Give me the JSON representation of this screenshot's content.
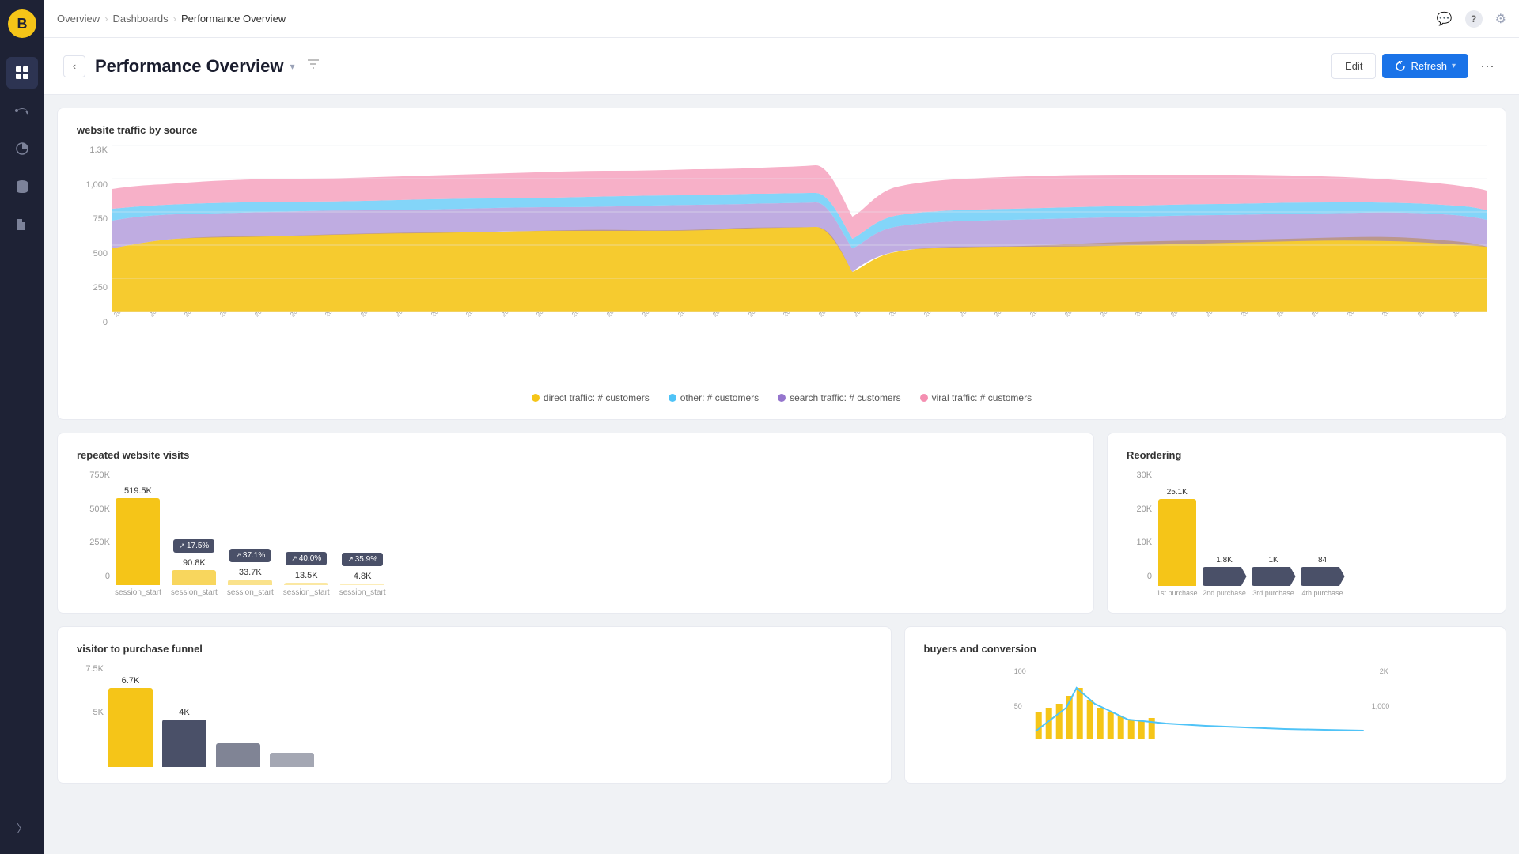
{
  "app": {
    "logo": "B",
    "logo_bg": "#f5c518"
  },
  "breadcrumb": {
    "items": [
      "Overview",
      "Dashboards",
      "Performance Overview"
    ],
    "separator": "›"
  },
  "topbar": {
    "chat_icon": "💬",
    "help_icon": "?",
    "settings_icon": "⚙"
  },
  "header": {
    "title": "Performance Overview",
    "back_label": "‹",
    "dropdown_icon": "▾",
    "filter_icon": "⊲",
    "edit_label": "Edit",
    "refresh_label": "Refresh",
    "more_icon": "···"
  },
  "nav_icons": [
    {
      "name": "dashboard-icon",
      "symbol": "▦",
      "active": true
    },
    {
      "name": "megaphone-icon",
      "symbol": "📢",
      "active": false
    },
    {
      "name": "chart-icon",
      "symbol": "◔",
      "active": false
    },
    {
      "name": "database-icon",
      "symbol": "◫",
      "active": false
    },
    {
      "name": "folder-icon",
      "symbol": "▭",
      "active": false
    }
  ],
  "traffic_chart": {
    "title": "website traffic by source",
    "y_labels": [
      "1.3K",
      "1,000",
      "750",
      "500",
      "250",
      "0"
    ],
    "x_labels": [
      "2017-12-31",
      "2018-01-20",
      "2018-01-30",
      "2018-02-09",
      "2018-02-19",
      "2018-03-01",
      "2018-03-11",
      "2018-03-31",
      "2018-04-10",
      "2018-04-20",
      "2018-04-30",
      "2018-05-10",
      "2018-05-20",
      "2018-05-30",
      "2018-06-09",
      "2018-06-19",
      "2018-06-29",
      "2018-07-09",
      "2018-07-19",
      "2018-07-29",
      "2018-08-08",
      "2018-08-18",
      "2018-08-28",
      "2018-09-07",
      "2018-09-17",
      "2018-09-27",
      "2018-10-07",
      "2018-10-17",
      "2018-10-27",
      "2018-11-06",
      "2018-11-16",
      "2018-11-26",
      "2018-12-06",
      "2018-12-16",
      "2018-12-26",
      "2019-01-05",
      "2019-01-25",
      "2019-02-04",
      "2019-02-14",
      "2019-02-24",
      "2019-03-06",
      "2019-03-16",
      "2019-03-26",
      "2019-04-05",
      "2019-04-15",
      "2019-04-25",
      "2019-05-05",
      "2019-05-15",
      "2019-05-25",
      "2019-06-04",
      "2019-06-14",
      "2019-06-24",
      "2019-07-04",
      "2019-07-14",
      "2019-07-24",
      "2019-08-03",
      "2019-08-13",
      "2019-08-23",
      "2019-09-02",
      "2019-09-12",
      "2019-09-22",
      "2019-10-02",
      "2019-10-12",
      "2019-10-22",
      "2019-11-01",
      "2019-11-11",
      "2019-11-21",
      "2019-12-01",
      "2019-12-11",
      "2019-12-21",
      "2019-12-31",
      "2020-01-10",
      "2020-01-20",
      "2020-01-30",
      "2020-02-09",
      "2020-02-19",
      "2020-02-29"
    ],
    "legend": [
      {
        "label": "direct traffic: # customers",
        "color": "#f5c518"
      },
      {
        "label": "other: # customers",
        "color": "#4fc3f7"
      },
      {
        "label": "search traffic: # customers",
        "color": "#9575cd"
      },
      {
        "label": "viral traffic: # customers",
        "color": "#f48fb1"
      }
    ]
  },
  "repeated_visits": {
    "title": "repeated website visits",
    "y_labels": [
      "750K",
      "500K",
      "250K",
      "0"
    ],
    "bars": [
      {
        "value": "519.5K",
        "label": "session_start",
        "height_pct": 100,
        "is_yellow": true,
        "arrow": null
      },
      {
        "value": "90.8K",
        "label": "session_start",
        "height_pct": 17,
        "is_yellow": false,
        "arrow": "17.5%"
      },
      {
        "value": "33.7K",
        "label": "session_start",
        "height_pct": 6,
        "is_yellow": false,
        "arrow": "37.1%"
      },
      {
        "value": "13.5K",
        "label": "session_start",
        "height_pct": 3,
        "is_yellow": false,
        "arrow": "40.0%"
      },
      {
        "value": "4.8K",
        "label": "session_start",
        "height_pct": 1,
        "is_yellow": false,
        "arrow": "35.9%"
      }
    ]
  },
  "reordering": {
    "title": "Reordering",
    "y_labels": [
      "30K",
      "20K",
      "10K",
      "0"
    ],
    "bars": [
      {
        "value": "25.1K",
        "label": "1st purchase",
        "height_pct": 100,
        "is_yellow": true
      },
      {
        "value": "1.8K",
        "label": "2nd purchase",
        "height_pct": 7,
        "is_yellow": false
      },
      {
        "value": "1K",
        "label": "3rd purchase",
        "height_pct": 4,
        "is_yellow": false
      },
      {
        "value": "84",
        "label": "4th purchase",
        "height_pct": 1,
        "is_yellow": false
      }
    ]
  },
  "visitor_funnel": {
    "title": "visitor to purchase funnel",
    "y_labels": [
      "7.5K",
      "5K"
    ],
    "bars": [
      {
        "value": "6.7K",
        "label": "",
        "height_pct": 100,
        "is_yellow": true
      },
      {
        "value": "4K",
        "label": "",
        "height_pct": 60,
        "is_dark": true
      }
    ]
  },
  "buyers": {
    "title": "buyers and conversion",
    "y_left_labels": [
      "100",
      "50"
    ],
    "y_right_labels": [
      "2K",
      "1,000"
    ]
  }
}
